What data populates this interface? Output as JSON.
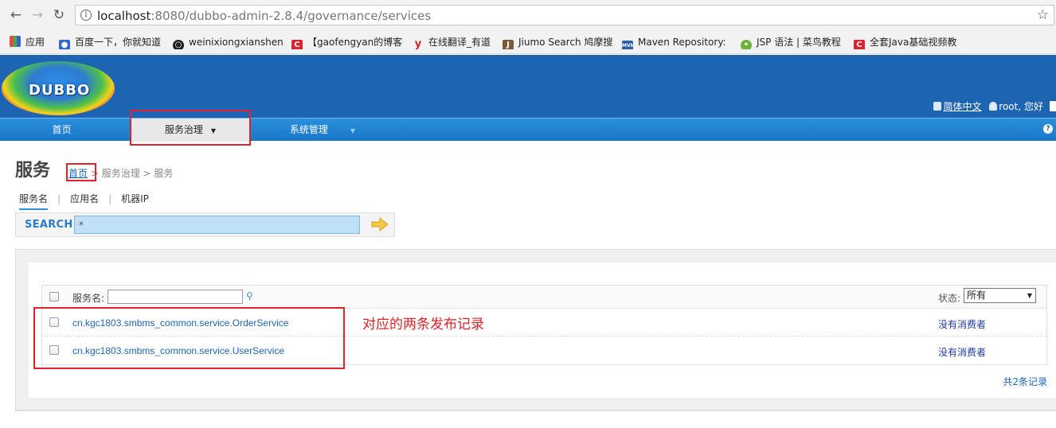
{
  "browser": {
    "url_host": "localhost",
    "url_rest": ":8080/dubbo-admin-2.8.4/governance/services",
    "bookmarks": [
      {
        "label": "应用",
        "icon": "apps-grid-icon"
      },
      {
        "label": "百度一下，你就知道",
        "icon": "baidu-paw-icon"
      },
      {
        "label": "weinixiongxianshen",
        "icon": "github-icon"
      },
      {
        "label": "【gaofengyan的博客",
        "icon": "csdn-icon"
      },
      {
        "label": "在线翻译_有道",
        "icon": "youdao-icon"
      },
      {
        "label": "Jiumo Search 鸠摩搜",
        "icon": "jiumo-icon"
      },
      {
        "label": "Maven Repository:",
        "icon": "mvn-icon"
      },
      {
        "label": "JSP 语法 | 菜鸟教程",
        "icon": "runoob-icon"
      },
      {
        "label": "全套Java基础视频教",
        "icon": "csdn-icon"
      }
    ]
  },
  "header": {
    "logo_text": "DUBBO",
    "lang_link": "简体中文",
    "user_greeting": "root, 您好"
  },
  "menu": {
    "items": [
      {
        "label": "首页"
      },
      {
        "label": "服务治理",
        "caret": "▼"
      },
      {
        "label": "系统管理",
        "caret": "▼"
      }
    ]
  },
  "page": {
    "title": "服务",
    "breadcrumb_home": "首页",
    "breadcrumb_rest": " > 服务治理 > 服务",
    "tabs": [
      "服务名",
      "应用名",
      "机器IP"
    ]
  },
  "search": {
    "label": "SEARCH",
    "value": "*"
  },
  "table": {
    "filter_label": "服务名:",
    "status_label": "状态:",
    "status_value": "所有",
    "rows": [
      {
        "service": "cn.kgc1803.smbms_common.service.OrderService",
        "consumer": "没有消费者"
      },
      {
        "service": "cn.kgc1803.smbms_common.service.UserService",
        "consumer": "没有消费者"
      }
    ],
    "total": "共2条记录"
  },
  "annotation": {
    "text": "对应的两条发布记录",
    "color": "#e0222a"
  }
}
